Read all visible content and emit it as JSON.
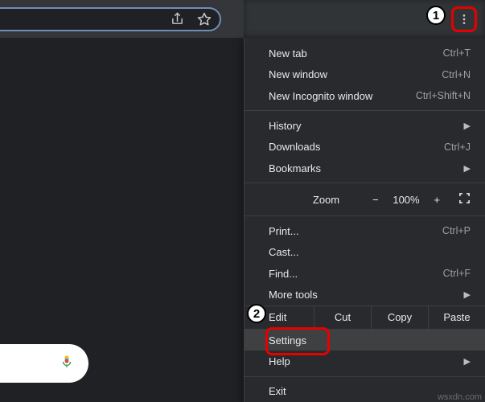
{
  "callouts": {
    "one": "1",
    "two": "2"
  },
  "menu": {
    "new_tab": {
      "label": "New tab",
      "hotkey": "Ctrl+T"
    },
    "new_window": {
      "label": "New window",
      "hotkey": "Ctrl+N"
    },
    "new_incognito": {
      "label": "New Incognito window",
      "hotkey": "Ctrl+Shift+N"
    },
    "history": {
      "label": "History"
    },
    "downloads": {
      "label": "Downloads",
      "hotkey": "Ctrl+J"
    },
    "bookmarks": {
      "label": "Bookmarks"
    },
    "zoom": {
      "label": "Zoom",
      "minus": "−",
      "pct": "100%",
      "plus": "+"
    },
    "print": {
      "label": "Print...",
      "hotkey": "Ctrl+P"
    },
    "cast": {
      "label": "Cast..."
    },
    "find": {
      "label": "Find...",
      "hotkey": "Ctrl+F"
    },
    "more_tools": {
      "label": "More tools"
    },
    "edit": {
      "label": "Edit",
      "cut": "Cut",
      "copy": "Copy",
      "paste": "Paste"
    },
    "settings": {
      "label": "Settings"
    },
    "help": {
      "label": "Help"
    },
    "exit": {
      "label": "Exit"
    }
  },
  "watermark": "wsxdn.com"
}
